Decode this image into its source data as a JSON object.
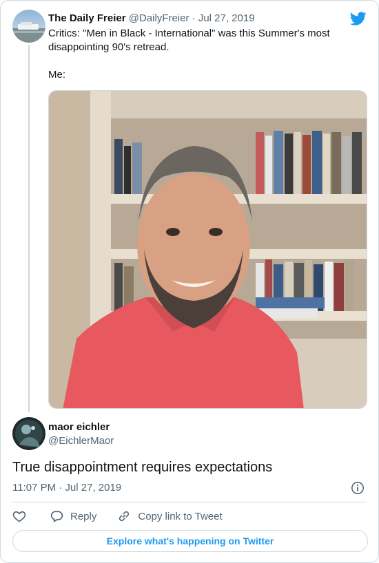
{
  "parent_tweet": {
    "author_name": "The Daily Freier",
    "author_handle": "@DailyFreier",
    "separator": "·",
    "date": "Jul 27, 2019",
    "text_line1": "Critics: \"Men in Black - International\" was this Summer's most disappointing 90's retread.",
    "text_line2": "Me:",
    "media_alt": "photo",
    "avatar_icon": "landscape-avatar"
  },
  "tweet": {
    "author_name": "maor eichler",
    "author_handle": "@EichlerMaor",
    "text": "True disappointment requires expectations",
    "timestamp": "11:07 PM · Jul 27, 2019",
    "avatar_icon": "dark-avatar"
  },
  "actions": {
    "like_icon": "heart-icon",
    "reply_label": "Reply",
    "copy_label": "Copy link to Tweet"
  },
  "footer": {
    "explore_label": "Explore what's happening on Twitter"
  },
  "colors": {
    "twitter_blue": "#1d9bf0",
    "text_primary": "#0f1419",
    "text_secondary": "#536471",
    "border": "#cfd9de"
  }
}
